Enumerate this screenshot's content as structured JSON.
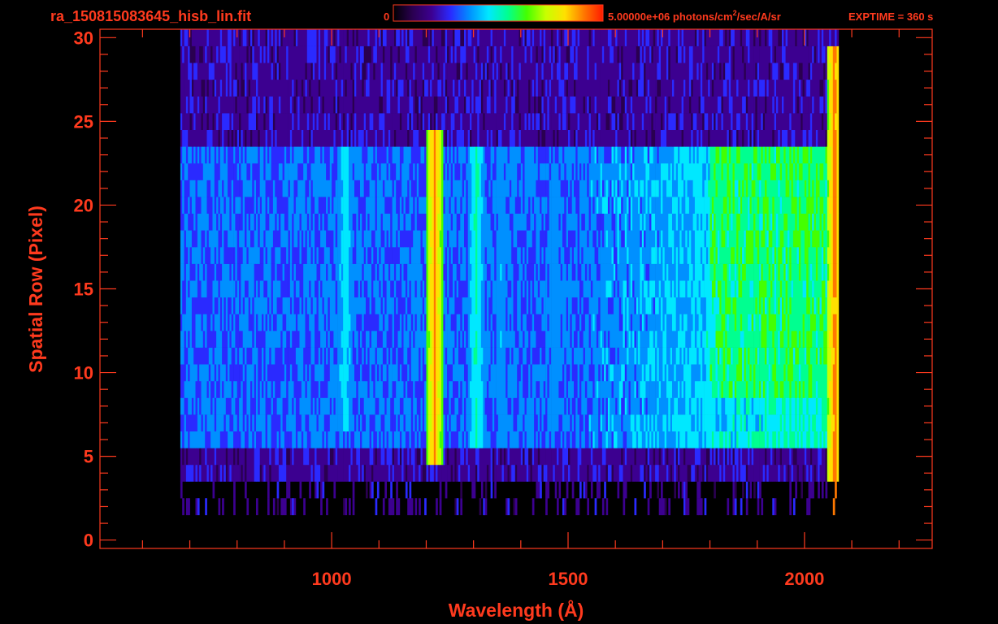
{
  "header": {
    "filename": "ra_150815083645_hisb_lin.fit",
    "colorbar_min": "0",
    "colorbar_max_prefix": "5.00000e+06 photons/cm",
    "colorbar_max_sup": "2",
    "colorbar_max_suffix": "/sec/A/sr",
    "exptime": "EXPTIME = 360 s"
  },
  "colors": {
    "axis": "#ff3a1e",
    "background": "#000000",
    "colormap": [
      "#000000",
      "#2a0050",
      "#3c0090",
      "#2a2aff",
      "#0090ff",
      "#00e8ff",
      "#00ff90",
      "#44ff00",
      "#c8ff00",
      "#ffe000",
      "#ff7800",
      "#ff1a00"
    ]
  },
  "chart_data": {
    "type": "heatmap",
    "title": "",
    "xlabel": "Wavelength (Å)",
    "ylabel": "Spatial Row (Pixel)",
    "xlim": [
      510,
      2270
    ],
    "ylim": [
      -0.5,
      30.5
    ],
    "x_ticks": [
      1000,
      1500,
      2000
    ],
    "x_tick_labels": [
      "1000",
      "1500",
      "2000"
    ],
    "y_ticks": [
      0,
      5,
      10,
      15,
      20,
      25,
      30
    ],
    "y_tick_labels": [
      "0",
      "5",
      "10",
      "15",
      "20",
      "25",
      "30"
    ],
    "x_data_range": [
      680,
      2070
    ],
    "colorbar_range": [
      0,
      5000000
    ],
    "colorbar_units": "photons/cm^2/sec/A/sr",
    "emission_lines": [
      {
        "wavelength": 1026,
        "rows": [
          7,
          23
        ],
        "level": 0.5
      },
      {
        "wavelength": 1216,
        "rows": [
          5,
          24
        ],
        "level": 0.92
      },
      {
        "wavelength": 1304,
        "rows": [
          6,
          23
        ],
        "level": 0.55
      },
      {
        "wavelength": 1356,
        "rows": [
          7,
          23
        ],
        "level": 0.42
      },
      {
        "wavelength": 1470,
        "rows": [
          7,
          22
        ],
        "level": 0.4
      },
      {
        "wavelength": 1800,
        "rows": [
          6,
          23
        ],
        "level": 0.5
      },
      {
        "wavelength": 2062,
        "rows": [
          2,
          29
        ],
        "level": 0.95
      }
    ],
    "continuum_region": {
      "x": [
        1800,
        2060
      ],
      "rows": [
        9,
        23
      ],
      "level": 0.55
    }
  }
}
